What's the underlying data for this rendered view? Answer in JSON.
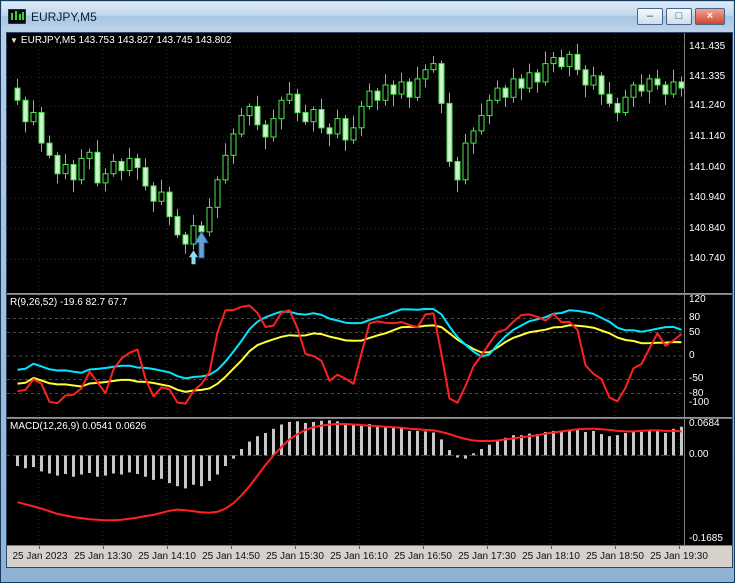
{
  "window": {
    "title": "EURJPY,M5",
    "controls": {
      "minimize": "–",
      "maximize": "□",
      "close": "×"
    }
  },
  "chart": {
    "dropdown_icon": "▼",
    "main_header": "EURJPY,M5 143.753 143.827 143.745 143.802",
    "price_axis": [
      "141.435",
      "141.335",
      "141.240",
      "141.140",
      "141.040",
      "140.940",
      "140.840",
      "140.740"
    ],
    "time_axis": [
      "25 Jan 2023",
      "25 Jan 13:30",
      "25 Jan 14:10",
      "25 Jan 14:50",
      "25 Jan 15:30",
      "25 Jan 16:10",
      "25 Jan 16:50",
      "25 Jan 17:30",
      "25 Jan 18:10",
      "25 Jan 18:50",
      "25 Jan 19:30"
    ]
  },
  "wpr": {
    "label": "R(9,26,52) -19.6 82.7 67.7",
    "axis": [
      "120",
      "80",
      "50",
      "0",
      "-50",
      "-80",
      "-100"
    ],
    "levels": [
      80,
      50,
      0,
      -50,
      -80
    ],
    "range": [
      -130,
      130
    ],
    "lines": [
      {
        "name": "fast",
        "color": "#ff2020",
        "width": 2,
        "period": 9,
        "smooth": 2,
        "scale": 232,
        "offset": -116
      },
      {
        "name": "mid",
        "color": "#00e6ff",
        "width": 2,
        "period": 26,
        "smooth": 6,
        "scale": 175,
        "offset": -60
      },
      {
        "name": "slow",
        "color": "#ffff33",
        "width": 2,
        "period": 52,
        "smooth": 6,
        "scale": 165,
        "offset": -88
      }
    ]
  },
  "macd": {
    "label": "MACD(12,26,9) 0.0541 0.0626",
    "axis": [
      "0.0684",
      "0.00",
      "-0.1685"
    ],
    "range": [
      -0.1685,
      0.0684
    ]
  },
  "colors": {
    "background": "#000000",
    "grid": "#2e2e2e",
    "level": "#4a4a4a",
    "bull_stroke": "#4ce44c",
    "bear_fill": "#c9f6c9",
    "bull_fill": "#000000",
    "macd_hist": "#c8c8c8",
    "macd_signal": "#ff2020",
    "arrow": "#6a9fd8",
    "arrow_outline": "#2e6da4",
    "arrow_small": "#8fdcef",
    "scale_text": "#ffffff"
  },
  "chart_data": {
    "type": "candlestick",
    "symbol": "EURJPY",
    "timeframe": "M5",
    "title": "EURJPY,M5",
    "price_range": [
      140.63,
      141.48
    ],
    "price_ticks": [
      141.435,
      141.335,
      141.24,
      141.14,
      141.04,
      140.94,
      140.84,
      140.74
    ],
    "first_open": 141.3,
    "closes": [
      141.26,
      141.19,
      141.22,
      141.12,
      141.08,
      141.02,
      141.05,
      141.0,
      141.07,
      141.09,
      140.99,
      141.02,
      141.06,
      141.03,
      141.07,
      141.04,
      140.98,
      140.93,
      140.96,
      140.88,
      140.82,
      140.79,
      140.85,
      140.83,
      140.91,
      141.0,
      141.08,
      141.15,
      141.21,
      141.24,
      141.18,
      141.14,
      141.2,
      141.26,
      141.28,
      141.22,
      141.19,
      141.23,
      141.17,
      141.15,
      141.2,
      141.13,
      141.17,
      141.24,
      141.29,
      141.26,
      141.31,
      141.28,
      141.32,
      141.27,
      141.33,
      141.36,
      141.38,
      141.25,
      141.06,
      141.0,
      141.12,
      141.16,
      141.21,
      141.26,
      141.3,
      141.27,
      141.33,
      141.3,
      141.35,
      141.32,
      141.38,
      141.4,
      141.37,
      141.41,
      141.36,
      141.31,
      141.34,
      141.28,
      141.25,
      141.22,
      141.27,
      141.31,
      141.29,
      141.33,
      141.31,
      141.28,
      141.32,
      141.3
    ],
    "wick_high": [
      0.03,
      0.012,
      0.04,
      0.018,
      0.025,
      0.01,
      0.035,
      0.015
    ],
    "wick_low": [
      0.015,
      0.035,
      0.012,
      0.028,
      0.01,
      0.032,
      0.018,
      0.04
    ],
    "macd_histogram": [
      -0.02,
      -0.024,
      -0.022,
      -0.03,
      -0.034,
      -0.038,
      -0.035,
      -0.04,
      -0.036,
      -0.033,
      -0.04,
      -0.038,
      -0.034,
      -0.036,
      -0.032,
      -0.035,
      -0.04,
      -0.046,
      -0.044,
      -0.052,
      -0.058,
      -0.062,
      -0.055,
      -0.058,
      -0.048,
      -0.036,
      -0.02,
      -0.006,
      0.012,
      0.026,
      0.036,
      0.042,
      0.05,
      0.058,
      0.063,
      0.064,
      0.061,
      0.063,
      0.065,
      0.066,
      0.064,
      0.059,
      0.057,
      0.058,
      0.059,
      0.056,
      0.055,
      0.052,
      0.051,
      0.046,
      0.046,
      0.045,
      0.043,
      0.03,
      0.01,
      -0.004,
      -0.006,
      0.004,
      0.012,
      0.02,
      0.028,
      0.033,
      0.038,
      0.038,
      0.041,
      0.04,
      0.044,
      0.046,
      0.044,
      0.046,
      0.048,
      0.044,
      0.046,
      0.04,
      0.036,
      0.038,
      0.042,
      0.046,
      0.044,
      0.048,
      0.046,
      0.042,
      0.05,
      0.054
    ],
    "macd_signal": [
      -0.088,
      -0.092,
      -0.096,
      -0.1,
      -0.105,
      -0.11,
      -0.113,
      -0.116,
      -0.118,
      -0.12,
      -0.121,
      -0.122,
      -0.122,
      -0.121,
      -0.119,
      -0.117,
      -0.114,
      -0.112,
      -0.108,
      -0.104,
      -0.102,
      -0.103,
      -0.105,
      -0.107,
      -0.108,
      -0.106,
      -0.1,
      -0.09,
      -0.075,
      -0.058,
      -0.038,
      -0.018,
      0.0,
      0.016,
      0.03,
      0.04,
      0.048,
      0.053,
      0.056,
      0.058,
      0.059,
      0.059,
      0.058,
      0.057,
      0.056,
      0.055,
      0.054,
      0.053,
      0.052,
      0.05,
      0.049,
      0.048,
      0.047,
      0.044,
      0.04,
      0.035,
      0.031,
      0.028,
      0.027,
      0.027,
      0.028,
      0.03,
      0.032,
      0.034,
      0.036,
      0.038,
      0.041,
      0.043,
      0.045,
      0.047,
      0.049,
      0.05,
      0.05,
      0.049,
      0.048,
      0.046,
      0.045,
      0.045,
      0.046,
      0.047,
      0.047,
      0.046,
      0.046,
      0.045
    ],
    "annotations": [
      {
        "type": "buy-arrow",
        "bar": 23,
        "price": 140.83
      },
      {
        "type": "tick-arrow",
        "bar": 22,
        "price": 140.77
      }
    ]
  }
}
